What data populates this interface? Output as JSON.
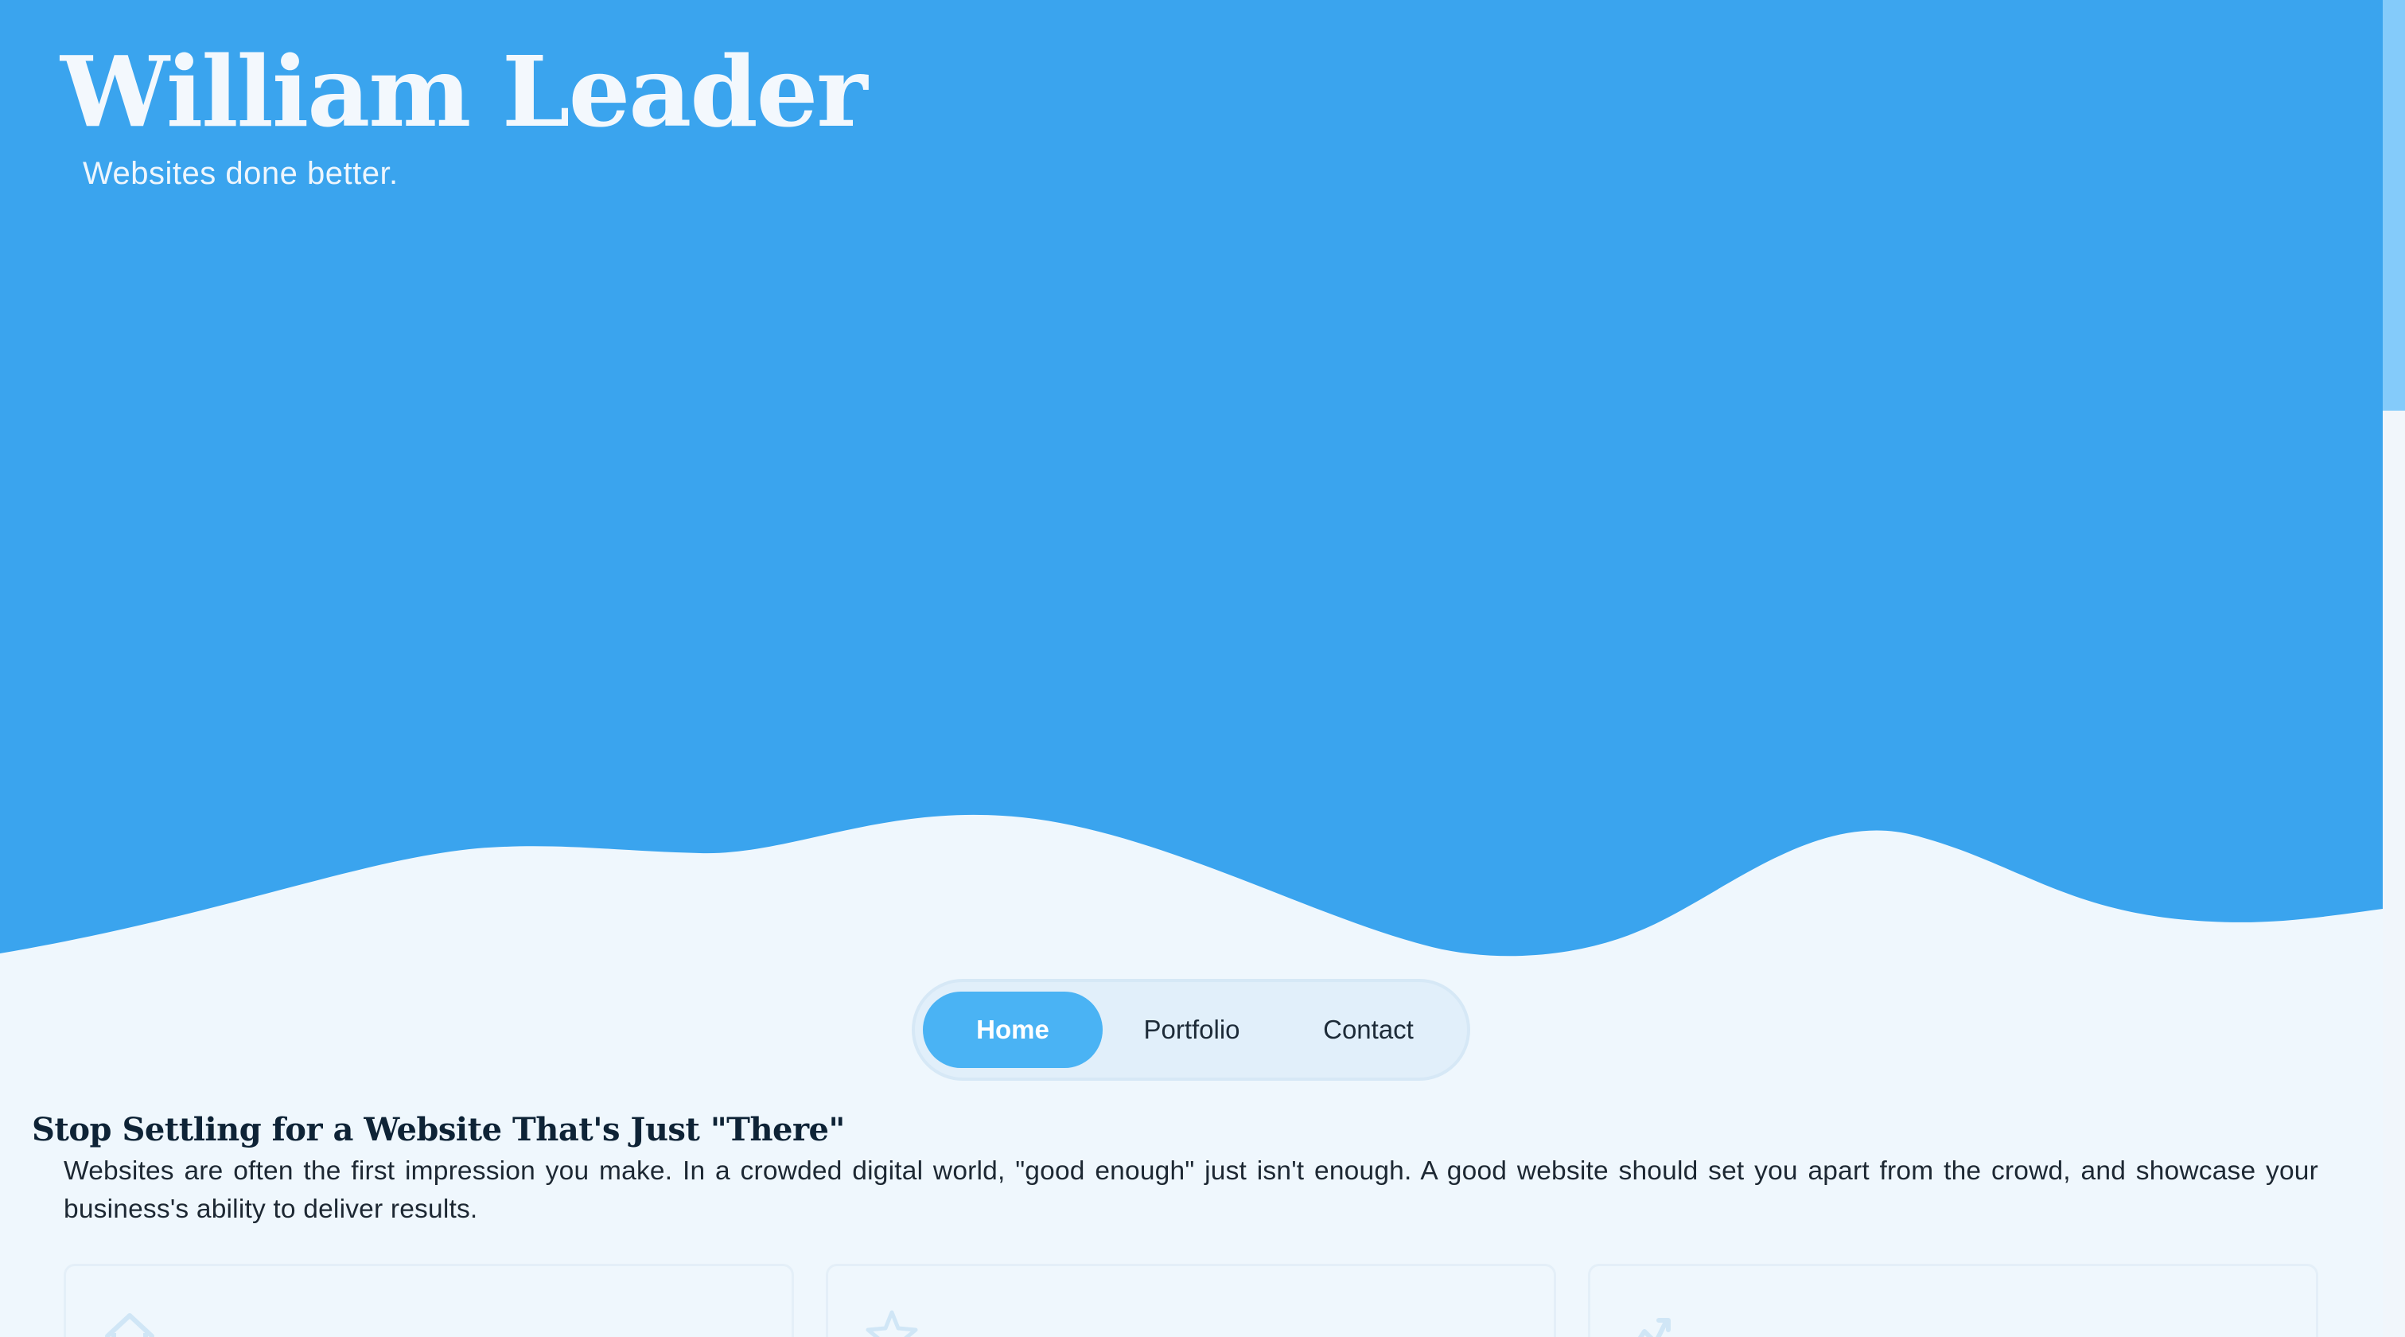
{
  "header": {
    "title": "William Leader",
    "tagline": "Websites done better."
  },
  "nav": {
    "items": [
      {
        "label": "Home",
        "active": true
      },
      {
        "label": "Portfolio",
        "active": false
      },
      {
        "label": "Contact",
        "active": false
      }
    ]
  },
  "intro": {
    "heading": "Stop Settling for a Website That's Just \"There\"",
    "body": "Websites are often the first impression you make. In a crowded digital world, \"good enough\" just isn't enough. A good website should set you apart from the crowd, and showcase your business's ability to deliver results."
  },
  "cards": [
    {
      "icon": "home-icon"
    },
    {
      "icon": "star-icon"
    },
    {
      "icon": "chart-icon"
    }
  ],
  "colors": {
    "hero": "#3aa4ee",
    "background": "#eff7fd",
    "accent": "#4ab3f4",
    "scrollbar_thumb": "#84cbfa"
  }
}
